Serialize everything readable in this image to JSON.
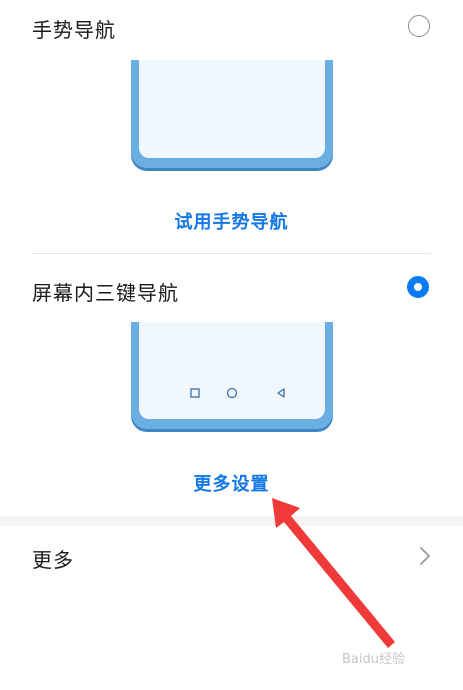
{
  "gesture_nav": {
    "title": "手势导航",
    "selected": false,
    "try_link": "试用手势导航"
  },
  "three_key_nav": {
    "title": "屏幕内三键导航",
    "selected": true,
    "more_settings_link": "更多设置",
    "nav_keys": [
      "square-icon",
      "circle-icon",
      "triangle-back-icon"
    ]
  },
  "more_row": {
    "label": "更多"
  },
  "watermark": "Baidu经验",
  "colors": {
    "accent": "#1478e6",
    "radio_selected": "#0a7bf0",
    "phone_body": "#6aaee2",
    "arrow": "#f03a3a"
  }
}
